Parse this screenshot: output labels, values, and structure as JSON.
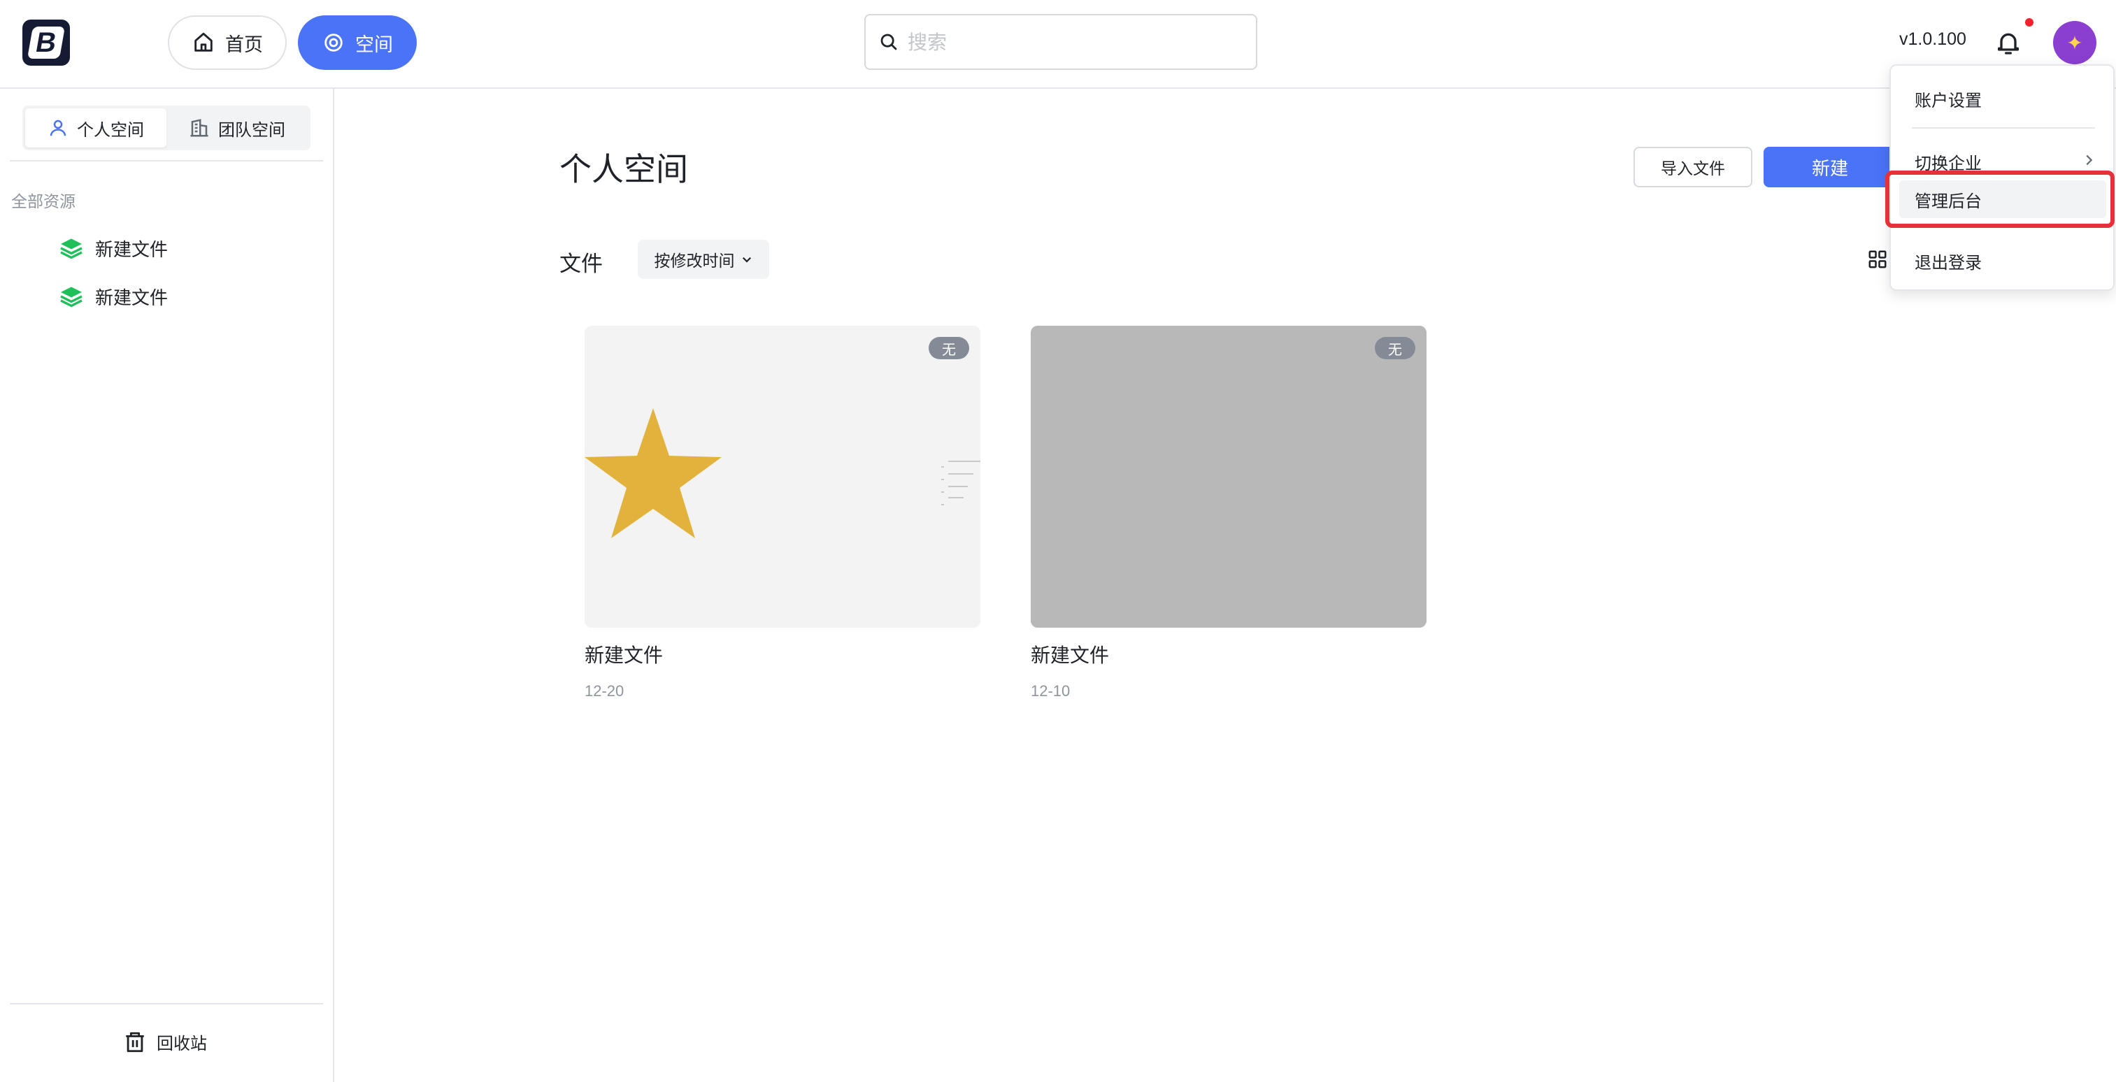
{
  "topbar": {
    "logo_text": "B",
    "nav": {
      "home_label": "首页",
      "space_label": "空间"
    },
    "search": {
      "placeholder": "搜索",
      "value": ""
    },
    "version": "v1.0.100",
    "avatar_icon": "avatar-image"
  },
  "sidebar": {
    "tabs": [
      {
        "label": "个人空间",
        "icon": "user-icon",
        "active": true
      },
      {
        "label": "团队空间",
        "icon": "building-icon",
        "active": false
      }
    ],
    "section_label": "全部资源",
    "items": [
      {
        "label": "新建文件",
        "icon": "layers-icon"
      },
      {
        "label": "新建文件",
        "icon": "layers-icon"
      }
    ],
    "trash_label": "回收站"
  },
  "main": {
    "title": "个人空间",
    "import_label": "导入文件",
    "new_label": "新建",
    "files_label": "文件",
    "sort_label": "按修改时间",
    "cards": [
      {
        "title": "新建文件",
        "date": "12-20",
        "badge": "无"
      },
      {
        "title": "新建文件",
        "date": "12-10",
        "badge": "无"
      }
    ]
  },
  "menu": {
    "items": [
      "账户设置",
      "切换企业",
      "管理后台",
      "退出登录"
    ]
  },
  "colors": {
    "primary": "#4a73f7",
    "highlight": "#e8303a",
    "star": "#e3b23c",
    "tree_icon": "#1fbf5a"
  }
}
